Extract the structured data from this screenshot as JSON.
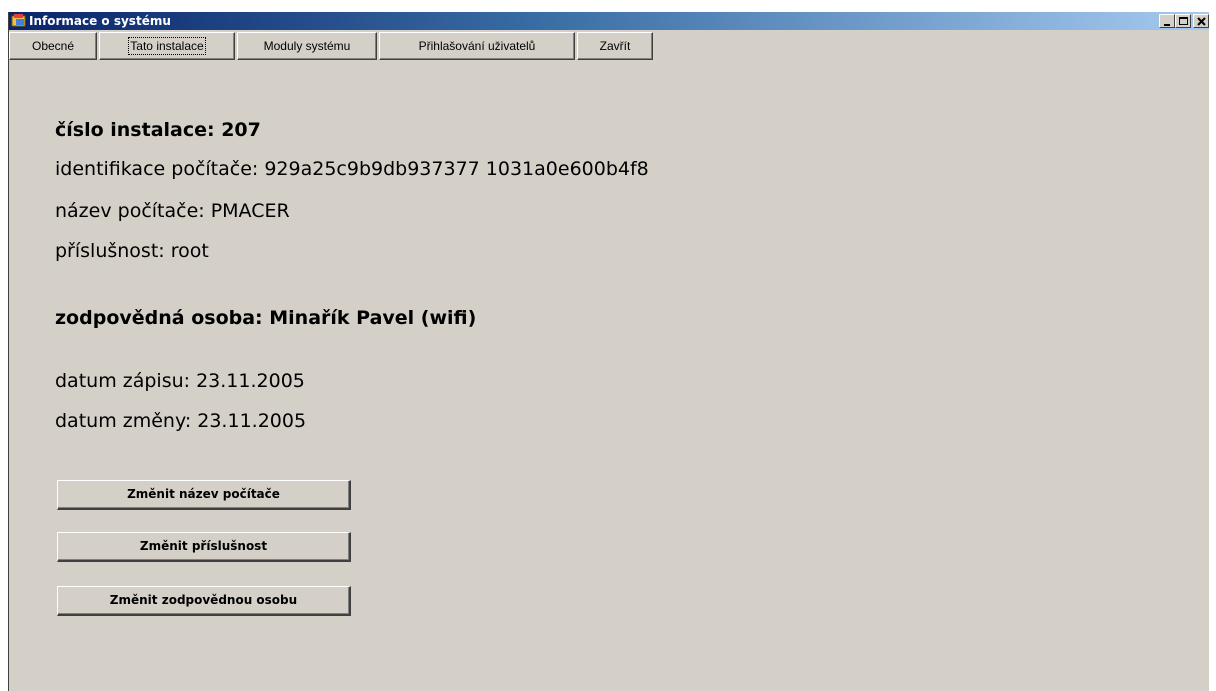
{
  "window": {
    "title": "Informace o systému",
    "controls": {
      "minimize": "minimize",
      "maximize": "maximize",
      "close": "close"
    }
  },
  "tabs": [
    {
      "label": "Obecné",
      "active": false
    },
    {
      "label": "Tato instalace",
      "active": true
    },
    {
      "label": "Moduly systému",
      "active": false
    },
    {
      "label": "Přihlašování uživatelů",
      "active": false
    },
    {
      "label": "Zavřít",
      "active": false
    }
  ],
  "info": {
    "installation_number": "číslo instalace: 207",
    "computer_id": "identifikace počítače: 929a25c9b9db937377 1031a0e600b4f8",
    "computer_name": "název počítače: PMACER",
    "membership": "příslušnost: root",
    "responsible_person": "zodpovědná osoba: Minařík Pavel (wifi)",
    "record_date": "datum zápisu: 23.11.2005",
    "change_date": "datum změny: 23.11.2005"
  },
  "buttons": {
    "change_name": "Změnit název počítače",
    "change_membership": "Změnit příslušnost",
    "change_person": "Změnit zodpovědnou osobu"
  },
  "colors": {
    "window_bg": "#d4d0c8",
    "titlebar_start": "#0a246a",
    "titlebar_end": "#a6caf0"
  }
}
